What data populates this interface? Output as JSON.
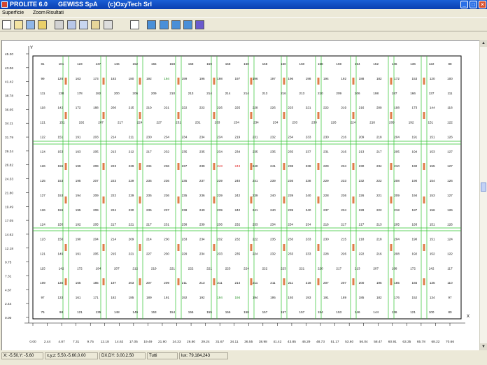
{
  "window": {
    "title": "PROLITE 6.0      GEWISS SpA      (c)OxyTech Srl"
  },
  "menu": {
    "items": [
      "Superficie",
      "Zoom",
      "Risultati"
    ]
  },
  "toolbar": {
    "buttons": [
      "new-icon",
      "open-icon",
      "edit-icon",
      "folder-icon",
      "luminaire-icon",
      "search-icon",
      "rotate-icon",
      "settings-icon",
      "page-icon",
      "view1-icon",
      "view2-icon",
      "view3-icon",
      "view4-icon",
      "view5-icon"
    ]
  },
  "chart_data": {
    "type": "table",
    "ylabel": "Y",
    "xlabel": "X",
    "y_ticks": [
      "45.20",
      "43.06",
      "41.42",
      "38.78",
      "36.05",
      "34.11",
      "31.79",
      "29.24",
      "26.82",
      "24.33",
      "21.80",
      "19.49",
      "17.05",
      "14.62",
      "12.18",
      "9.75",
      "7.31",
      "4.87",
      "2.44",
      "0.00"
    ],
    "x_ticks": [
      "0.00",
      "2.44",
      "4.87",
      "7.31",
      "9.75",
      "12.18",
      "14.62",
      "17.05",
      "19.49",
      "21.90",
      "24.33",
      "26.80",
      "29.24",
      "31.67",
      "34.11",
      "36.55",
      "38.98",
      "41.42",
      "43.85",
      "46.29",
      "48.73",
      "51.17",
      "53.60",
      "56.04",
      "58.47",
      "60.91",
      "63.35",
      "65.78",
      "68.22",
      "70.66"
    ],
    "rows": [
      [
        "81",
        "101",
        "123",
        "137",
        "146",
        "152",
        "155",
        "158",
        "158",
        "159",
        "158",
        "160",
        "158",
        "160",
        "160",
        "158",
        "159",
        "154",
        "152",
        "146",
        "136",
        "122",
        "88"
      ],
      [
        "99",
        "126",
        "163",
        "173",
        "183",
        "180",
        "192",
        "194",
        "199",
        "196",
        "198",
        "197",
        "196",
        "197",
        "196",
        "198",
        "194",
        "192",
        "188",
        "182",
        "172",
        "153",
        "120",
        "100"
      ],
      [
        "111",
        "138",
        "178",
        "182",
        "200",
        "206",
        "209",
        "210",
        "213",
        "214",
        "214",
        "214",
        "213",
        "216",
        "213",
        "210",
        "209",
        "206",
        "198",
        "187",
        "166",
        "137",
        "111"
      ],
      [
        "118",
        "142",
        "172",
        "188",
        "200",
        "215",
        "219",
        "221",
        "222",
        "222",
        "226",
        "225",
        "228",
        "226",
        "223",
        "221",
        "222",
        "219",
        "216",
        "209",
        "198",
        "173",
        "144",
        "118"
      ],
      [
        "121",
        "151",
        "192",
        "207",
        "217",
        "224",
        "227",
        "231",
        "231",
        "233",
        "234",
        "234",
        "234",
        "233",
        "230",
        "226",
        "224",
        "216",
        "209",
        "192",
        "151",
        "122"
      ],
      [
        "122",
        "151",
        "191",
        "203",
        "214",
        "211",
        "230",
        "234",
        "234",
        "234",
        "234",
        "219",
        "231",
        "232",
        "234",
        "233",
        "230",
        "216",
        "209",
        "218",
        "204",
        "191",
        "151",
        "126"
      ],
      [
        "124",
        "153",
        "193",
        "205",
        "213",
        "212",
        "217",
        "232",
        "235",
        "235",
        "234",
        "234",
        "235",
        "235",
        "235",
        "237",
        "231",
        "216",
        "213",
        "217",
        "205",
        "194",
        "153",
        "127"
      ],
      [
        "126",
        "155",
        "199",
        "209",
        "223",
        "229",
        "234",
        "236",
        "237",
        "239",
        "243",
        "243",
        "240",
        "241",
        "238",
        "238",
        "229",
        "234",
        "230",
        "234",
        "210",
        "190",
        "155",
        "127"
      ],
      [
        "125",
        "153",
        "195",
        "207",
        "223",
        "229",
        "235",
        "236",
        "235",
        "237",
        "239",
        "240",
        "241",
        "239",
        "236",
        "238",
        "229",
        "233",
        "232",
        "222",
        "208",
        "190",
        "154",
        "126"
      ],
      [
        "127",
        "153",
        "194",
        "209",
        "222",
        "229",
        "235",
        "236",
        "235",
        "236",
        "239",
        "242",
        "239",
        "240",
        "239",
        "240",
        "228",
        "236",
        "226",
        "221",
        "209",
        "194",
        "153",
        "127"
      ],
      [
        "126",
        "155",
        "195",
        "209",
        "224",
        "230",
        "235",
        "237",
        "238",
        "240",
        "239",
        "242",
        "241",
        "240",
        "239",
        "240",
        "237",
        "234",
        "228",
        "222",
        "218",
        "187",
        "156",
        "126"
      ],
      [
        "124",
        "150",
        "192",
        "205",
        "217",
        "221",
        "217",
        "231",
        "238",
        "239",
        "236",
        "232",
        "233",
        "234",
        "234",
        "234",
        "216",
        "217",
        "217",
        "213",
        "205",
        "193",
        "151",
        "126"
      ],
      [
        "123",
        "150",
        "190",
        "204",
        "214",
        "209",
        "214",
        "230",
        "233",
        "234",
        "232",
        "232",
        "222",
        "235",
        "233",
        "233",
        "230",
        "215",
        "218",
        "218",
        "204",
        "190",
        "151",
        "124"
      ],
      [
        "121",
        "149",
        "191",
        "205",
        "215",
        "221",
        "227",
        "230",
        "229",
        "234",
        "233",
        "235",
        "224",
        "232",
        "233",
        "233",
        "228",
        "226",
        "222",
        "216",
        "208",
        "192",
        "152",
        "122"
      ],
      [
        "115",
        "142",
        "172",
        "194",
        "207",
        "212",
        "219",
        "221",
        "222",
        "221",
        "223",
        "224",
        "222",
        "223",
        "221",
        "220",
        "217",
        "213",
        "207",
        "198",
        "172",
        "142",
        "117"
      ],
      [
        "109",
        "135",
        "165",
        "185",
        "197",
        "203",
        "207",
        "209",
        "211",
        "213",
        "211",
        "214",
        "211",
        "211",
        "211",
        "218",
        "207",
        "207",
        "200",
        "195",
        "185",
        "165",
        "135",
        "110"
      ],
      [
        "97",
        "133",
        "161",
        "171",
        "182",
        "185",
        "189",
        "191",
        "192",
        "192",
        "194",
        "194",
        "194",
        "195",
        "193",
        "193",
        "191",
        "189",
        "185",
        "182",
        "176",
        "152",
        "134",
        "97"
      ],
      [
        "76",
        "98",
        "121",
        "135",
        "148",
        "149",
        "153",
        "154",
        "156",
        "155",
        "156",
        "158",
        "157",
        "157",
        "157",
        "154",
        "153",
        "146",
        "144",
        "136",
        "121",
        "100",
        "80"
      ]
    ],
    "highlight_values": [
      "194",
      "243",
      "194"
    ],
    "colors": {
      "grid_green": "#2ec42e",
      "accent_red": "#e02020",
      "luminaire": "#e07d4a"
    }
  },
  "status": {
    "coords": "X: -5.50,Y: -5.60",
    "xyz": "x,y,z: 5.50,-5.60,0.00",
    "dxdy": "DX,DY: 3.00,2.50",
    "mode": "Tutti",
    "lux": "lux: 79,184,243"
  }
}
